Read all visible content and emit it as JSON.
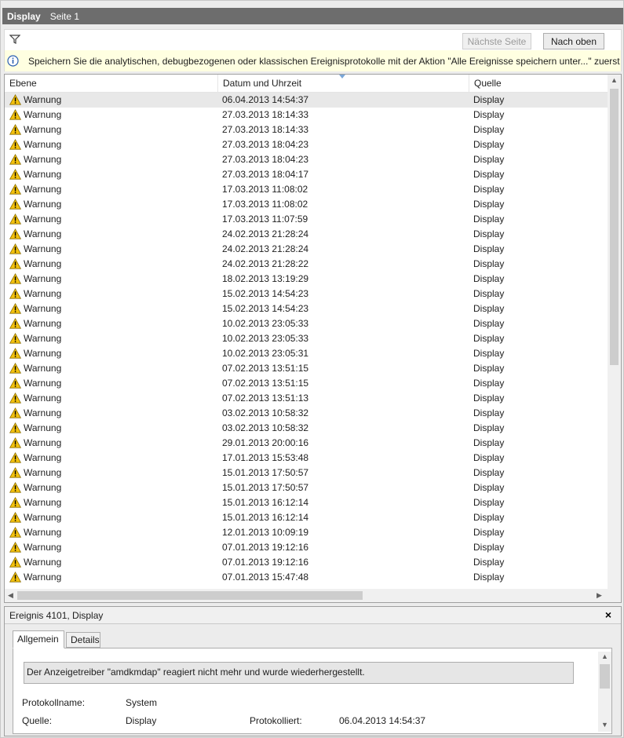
{
  "titlebar": {
    "title": "Display",
    "page": "Seite 1"
  },
  "toolbar": {
    "next_page": "Nächste Seite",
    "to_top": "Nach oben"
  },
  "info_message": "Speichern Sie die analytischen, debugbezogenen oder klassischen Ereignisprotokolle mit der Aktion \"Alle Ereignisse speichern unter...\" zuerst",
  "columns": {
    "level": "Ebene",
    "datetime": "Datum und Uhrzeit",
    "source": "Quelle"
  },
  "rows": [
    {
      "level": "Warnung",
      "datetime": "06.04.2013 14:54:37",
      "source": "Display"
    },
    {
      "level": "Warnung",
      "datetime": "27.03.2013 18:14:33",
      "source": "Display"
    },
    {
      "level": "Warnung",
      "datetime": "27.03.2013 18:14:33",
      "source": "Display"
    },
    {
      "level": "Warnung",
      "datetime": "27.03.2013 18:04:23",
      "source": "Display"
    },
    {
      "level": "Warnung",
      "datetime": "27.03.2013 18:04:23",
      "source": "Display"
    },
    {
      "level": "Warnung",
      "datetime": "27.03.2013 18:04:17",
      "source": "Display"
    },
    {
      "level": "Warnung",
      "datetime": "17.03.2013 11:08:02",
      "source": "Display"
    },
    {
      "level": "Warnung",
      "datetime": "17.03.2013 11:08:02",
      "source": "Display"
    },
    {
      "level": "Warnung",
      "datetime": "17.03.2013 11:07:59",
      "source": "Display"
    },
    {
      "level": "Warnung",
      "datetime": "24.02.2013 21:28:24",
      "source": "Display"
    },
    {
      "level": "Warnung",
      "datetime": "24.02.2013 21:28:24",
      "source": "Display"
    },
    {
      "level": "Warnung",
      "datetime": "24.02.2013 21:28:22",
      "source": "Display"
    },
    {
      "level": "Warnung",
      "datetime": "18.02.2013 13:19:29",
      "source": "Display"
    },
    {
      "level": "Warnung",
      "datetime": "15.02.2013 14:54:23",
      "source": "Display"
    },
    {
      "level": "Warnung",
      "datetime": "15.02.2013 14:54:23",
      "source": "Display"
    },
    {
      "level": "Warnung",
      "datetime": "10.02.2013 23:05:33",
      "source": "Display"
    },
    {
      "level": "Warnung",
      "datetime": "10.02.2013 23:05:33",
      "source": "Display"
    },
    {
      "level": "Warnung",
      "datetime": "10.02.2013 23:05:31",
      "source": "Display"
    },
    {
      "level": "Warnung",
      "datetime": "07.02.2013 13:51:15",
      "source": "Display"
    },
    {
      "level": "Warnung",
      "datetime": "07.02.2013 13:51:15",
      "source": "Display"
    },
    {
      "level": "Warnung",
      "datetime": "07.02.2013 13:51:13",
      "source": "Display"
    },
    {
      "level": "Warnung",
      "datetime": "03.02.2013 10:58:32",
      "source": "Display"
    },
    {
      "level": "Warnung",
      "datetime": "03.02.2013 10:58:32",
      "source": "Display"
    },
    {
      "level": "Warnung",
      "datetime": "29.01.2013 20:00:16",
      "source": "Display"
    },
    {
      "level": "Warnung",
      "datetime": "17.01.2013 15:53:48",
      "source": "Display"
    },
    {
      "level": "Warnung",
      "datetime": "15.01.2013 17:50:57",
      "source": "Display"
    },
    {
      "level": "Warnung",
      "datetime": "15.01.2013 17:50:57",
      "source": "Display"
    },
    {
      "level": "Warnung",
      "datetime": "15.01.2013 16:12:14",
      "source": "Display"
    },
    {
      "level": "Warnung",
      "datetime": "15.01.2013 16:12:14",
      "source": "Display"
    },
    {
      "level": "Warnung",
      "datetime": "12.01.2013 10:09:19",
      "source": "Display"
    },
    {
      "level": "Warnung",
      "datetime": "07.01.2013 19:12:16",
      "source": "Display"
    },
    {
      "level": "Warnung",
      "datetime": "07.01.2013 19:12:16",
      "source": "Display"
    },
    {
      "level": "Warnung",
      "datetime": "07.01.2013 15:47:48",
      "source": "Display"
    }
  ],
  "detail": {
    "title": "Ereignis 4101, Display",
    "close": "×",
    "tabs": {
      "general": "Allgemein",
      "details": "Details"
    },
    "message": "Der Anzeigetreiber \"amdkmdap\" reagiert nicht mehr und wurde wiederhergestellt.",
    "log_name_label": "Protokollname:",
    "log_name_value": "System",
    "source_label": "Quelle:",
    "source_value": "Display",
    "logged_label": "Protokolliert:",
    "logged_value": "06.04.2013 14:54:37"
  },
  "icons": {
    "filter": "filter-icon",
    "info": "info-icon",
    "warning": "warning-icon"
  },
  "colors": {
    "titlebar": "#6d6d6d",
    "infobar": "#ffffe1",
    "warning_fill": "#f4c20d"
  }
}
